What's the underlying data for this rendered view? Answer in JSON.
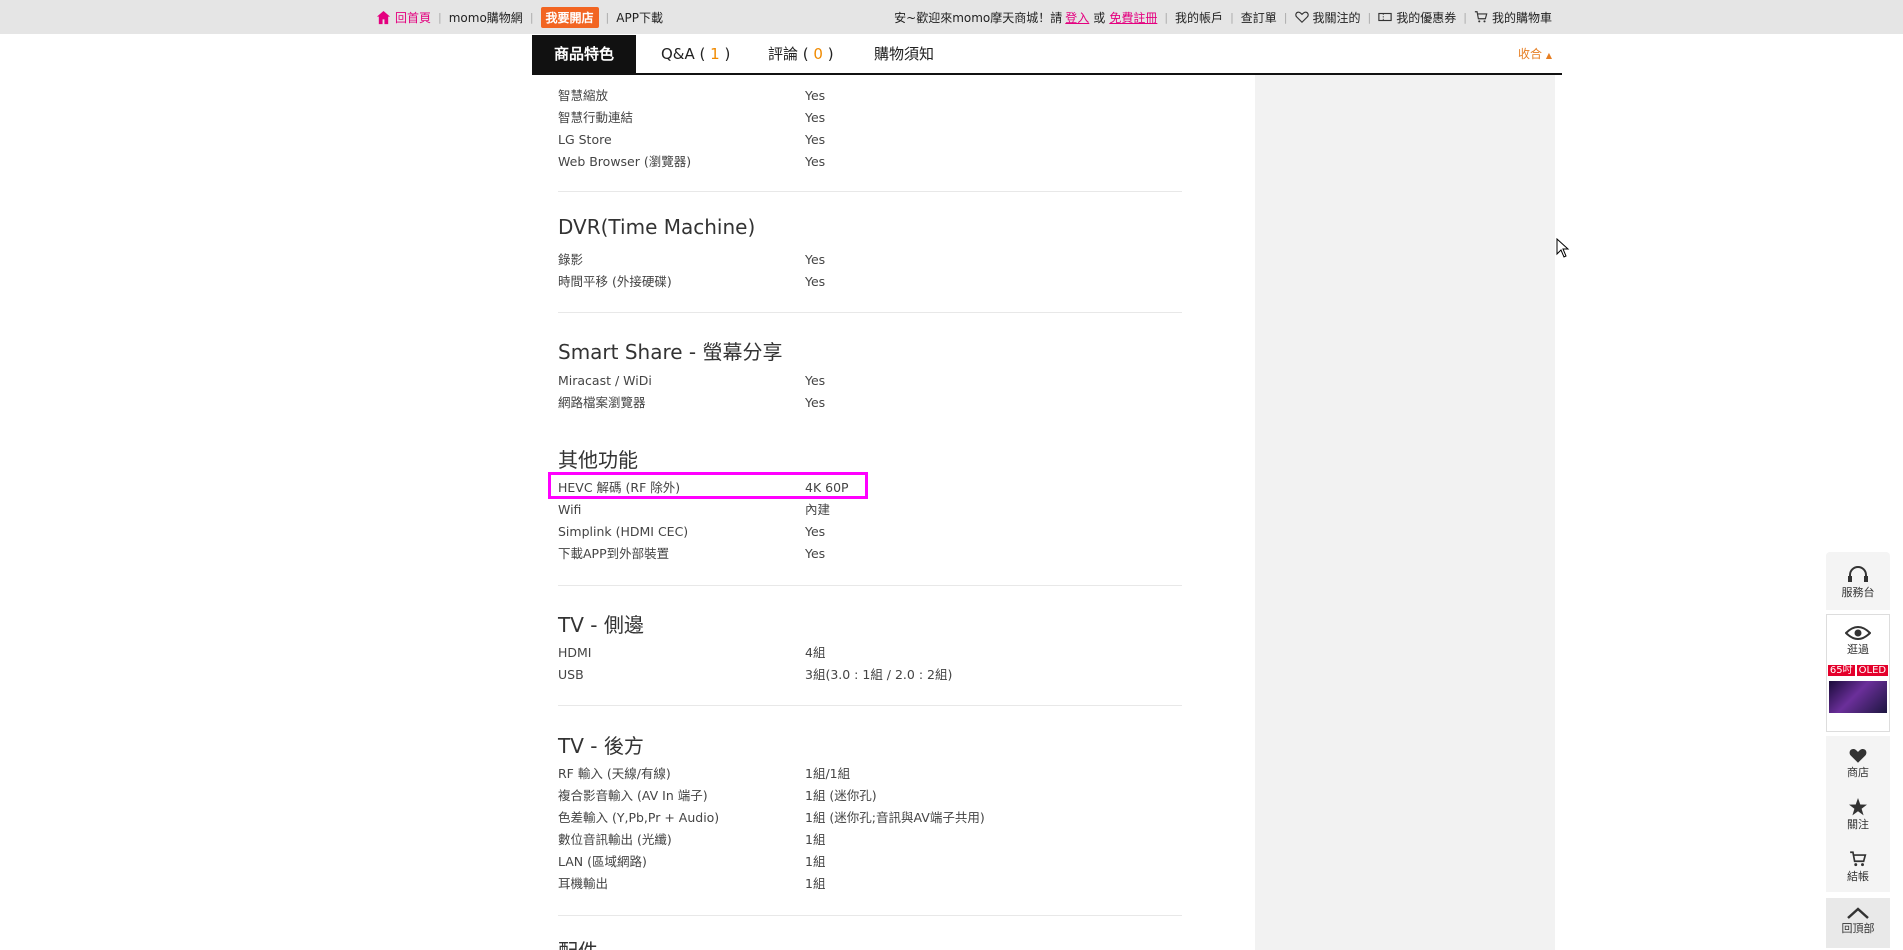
{
  "topbar": {
    "home": "回首頁",
    "momo_net": "momo購物網",
    "open_shop": "我要開店",
    "app_download": "APP下載",
    "welcome": "安~歡迎來momo摩天商城！請",
    "login": "登入",
    "or": "或",
    "register": "免費註冊",
    "my_account": "我的帳戶",
    "order_lookup": "查訂單",
    "my_follows": "我關注的",
    "my_coupons": "我的優惠券",
    "my_cart": "我的購物車"
  },
  "tabs": {
    "features": "商品特色",
    "qa": "Q&A (",
    "qa_count": "1",
    "reviews": "評論 (",
    "reviews_count": "0",
    "close_paren": " )",
    "notice": "購物須知",
    "collapse": "收合"
  },
  "sections": {
    "smart": {
      "rows": [
        {
          "k": "智慧縮放",
          "v": "Yes"
        },
        {
          "k": "智慧行動連結",
          "v": "Yes"
        },
        {
          "k": "LG Store",
          "v": "Yes"
        },
        {
          "k": "Web Browser (瀏覽器)",
          "v": "Yes"
        }
      ]
    },
    "dvr": {
      "title": "DVR(Time Machine)",
      "rows": [
        {
          "k": "錄影",
          "v": "Yes"
        },
        {
          "k": "時間平移 (外接硬碟)",
          "v": "Yes"
        }
      ]
    },
    "share": {
      "title": "Smart Share - 螢幕分享",
      "rows": [
        {
          "k": "Miracast / WiDi",
          "v": "Yes"
        },
        {
          "k": "網路檔案瀏覽器",
          "v": "Yes"
        }
      ]
    },
    "other": {
      "title": "其他功能",
      "rows": [
        {
          "k": "HEVC 解碼 (RF 除外)",
          "v": "4K 60P"
        },
        {
          "k": "Wifi",
          "v": "內建"
        },
        {
          "k": "Simplink (HDMI CEC)",
          "v": "Yes"
        },
        {
          "k": "下載APP到外部裝置",
          "v": "Yes"
        }
      ]
    },
    "side_io": {
      "title": "TV - 側邊",
      "rows": [
        {
          "k": "HDMI",
          "v": "4組"
        },
        {
          "k": "USB",
          "v": "3組(3.0 : 1組 / 2.0 : 2組)"
        }
      ]
    },
    "rear_io": {
      "title": "TV - 後方",
      "rows": [
        {
          "k": "RF 輸入 (天線/有線)",
          "v": "1組/1組"
        },
        {
          "k": "複合影音輸入 (AV In 端子)",
          "v": "1組 (迷你孔)"
        },
        {
          "k": "色差輸入 (Y,Pb,Pr + Audio)",
          "v": "1組 (迷你孔;音訊與AV端子共用)"
        },
        {
          "k": "數位音訊輸出 (光纖)",
          "v": "1組"
        },
        {
          "k": "LAN (區域網路)",
          "v": "1組"
        },
        {
          "k": "耳機輸出",
          "v": "1組"
        }
      ]
    },
    "accessories": {
      "title": "配件"
    }
  },
  "side": {
    "service": "服務台",
    "viewed": "逛過",
    "thumb_tag1": "65吋",
    "thumb_tag2": "OLED",
    "store": "商店",
    "follow": "關注",
    "checkout": "結帳",
    "top": "回頂部"
  },
  "colors": {
    "accent_pink": "#e4007f",
    "open_shop_orange": "#f26522",
    "highlight": "#ff00ff",
    "count_orange": "#f08a00"
  }
}
